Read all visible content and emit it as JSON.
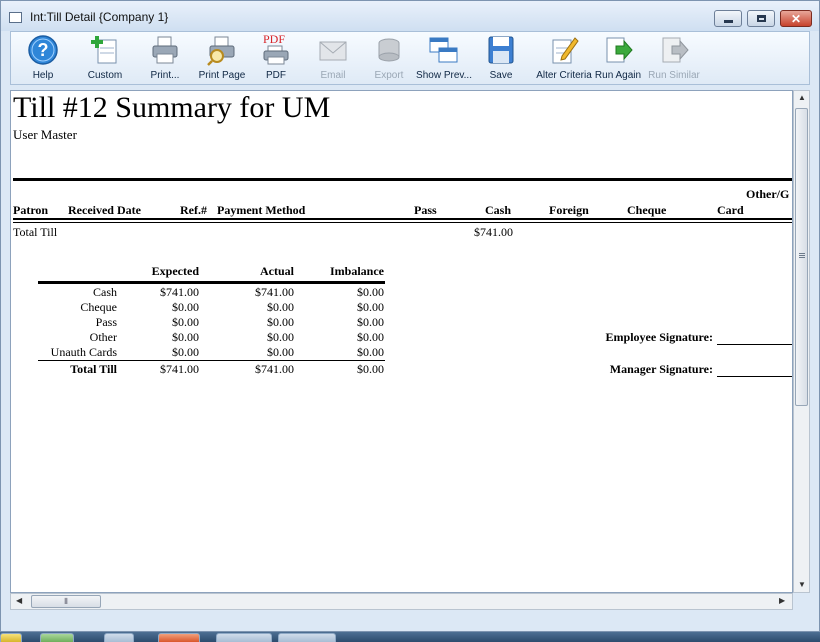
{
  "window": {
    "title": "Int:Till Detail {Company 1}"
  },
  "toolbar": {
    "buttons": [
      {
        "label": "Help",
        "icon": "help-icon",
        "enabled": true
      },
      {
        "label": "Custom",
        "icon": "custom-icon",
        "enabled": true
      },
      {
        "label": "Print...",
        "icon": "printer-icon",
        "enabled": true
      },
      {
        "label": "Print Page",
        "icon": "print-page-icon",
        "enabled": true
      },
      {
        "label": "PDF",
        "icon": "pdf-icon",
        "enabled": true
      },
      {
        "label": "Email",
        "icon": "email-icon",
        "enabled": false
      },
      {
        "label": "Export",
        "icon": "export-icon",
        "enabled": false
      },
      {
        "label": "Show Prev...",
        "icon": "show-preview-icon",
        "enabled": true
      },
      {
        "label": "Save",
        "icon": "save-icon",
        "enabled": true
      },
      {
        "label": "Alter Criteria",
        "icon": "alter-criteria-icon",
        "enabled": true
      },
      {
        "label": "Run Again",
        "icon": "run-again-icon",
        "enabled": true
      },
      {
        "label": "Run Similar",
        "icon": "run-similar-icon",
        "enabled": false
      }
    ],
    "pdf_badge": "PDF"
  },
  "report": {
    "title": "Till #12 Summary for UM",
    "subtitle": "User Master",
    "columns": {
      "patron": "Patron",
      "received_date": "Received Date",
      "ref": "Ref.#",
      "payment_method": "Payment Method",
      "pass": "Pass",
      "cash": "Cash",
      "foreign": "Foreign",
      "cheque": "Cheque",
      "card": "Card",
      "other": "Other/G"
    },
    "total_till": {
      "label": "Total Till",
      "cash": "$741.00"
    },
    "summary": {
      "headers": {
        "expected": "Expected",
        "actual": "Actual",
        "imbalance": "Imbalance"
      },
      "rows": [
        {
          "label": "Cash",
          "expected": "$741.00",
          "actual": "$741.00",
          "imbalance": "$0.00"
        },
        {
          "label": "Cheque",
          "expected": "$0.00",
          "actual": "$0.00",
          "imbalance": "$0.00"
        },
        {
          "label": "Pass",
          "expected": "$0.00",
          "actual": "$0.00",
          "imbalance": "$0.00"
        },
        {
          "label": "Other",
          "expected": "$0.00",
          "actual": "$0.00",
          "imbalance": "$0.00"
        },
        {
          "label": "Unauth Cards",
          "expected": "$0.00",
          "actual": "$0.00",
          "imbalance": "$0.00"
        }
      ],
      "total": {
        "label": "Total Till",
        "expected": "$741.00",
        "actual": "$741.00",
        "imbalance": "$0.00"
      }
    },
    "signatures": {
      "employee": "Employee Signature:",
      "manager": "Manager Signature:"
    }
  },
  "colors": {
    "titlebar": "#dbe7f5",
    "toolbar": "#e8f0f9",
    "close": "#c7422c"
  }
}
